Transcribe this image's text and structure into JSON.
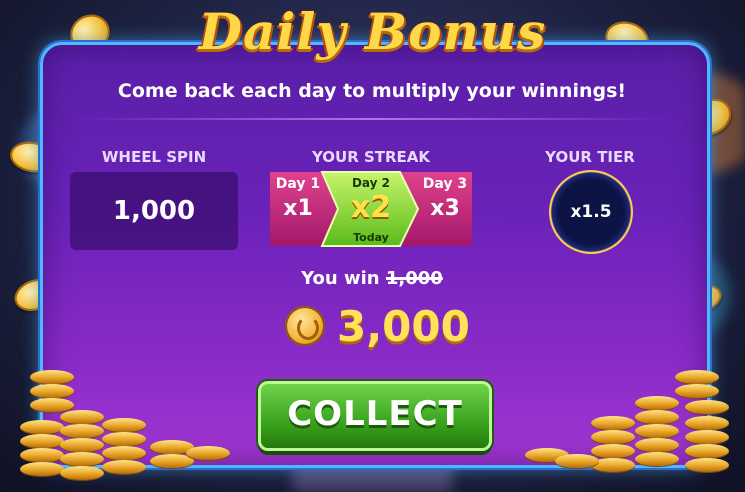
{
  "title": "Daily Bonus",
  "subtitle": "Come back each day to multiply your winnings!",
  "wheel_spin": {
    "label": "WHEEL SPIN",
    "value": "1,000"
  },
  "streak": {
    "label": "YOUR STREAK",
    "days": [
      {
        "name": "Day 1",
        "mult": "x1"
      },
      {
        "name": "Day 2",
        "mult": "x2",
        "tag": "Today"
      },
      {
        "name": "Day 3",
        "mult": "x3"
      }
    ]
  },
  "tier": {
    "label": "YOUR TIER",
    "value": "x1.5"
  },
  "result": {
    "prefix": "You win",
    "original": "1,000",
    "amount": "3,000",
    "icon": "coin-icon"
  },
  "collect_label": "COLLECT",
  "colors": {
    "panel": "#6a22b8",
    "border": "#4fb8ff",
    "gold": "#ffd84a",
    "button": "#3aa41e"
  }
}
